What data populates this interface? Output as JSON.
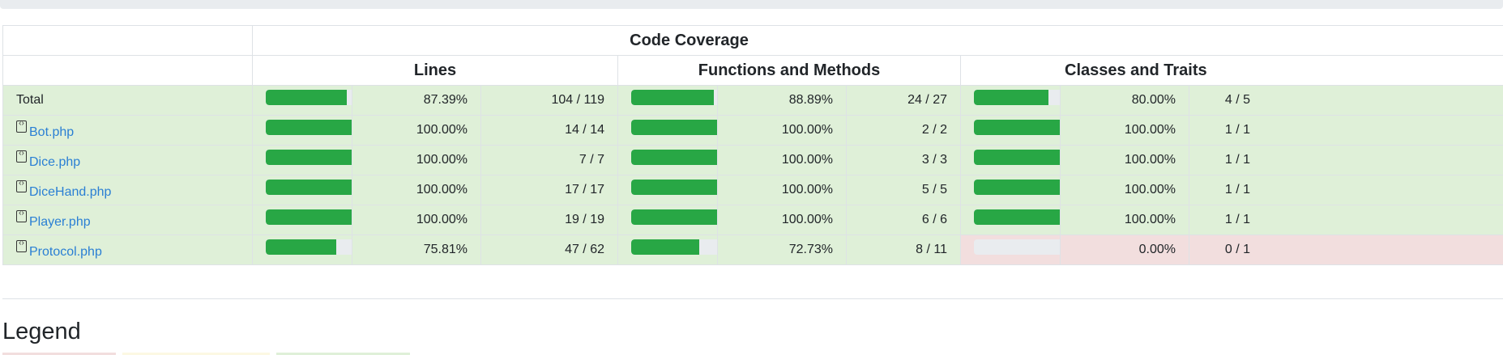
{
  "header": {
    "code_coverage": "Code Coverage",
    "columns": [
      "Lines",
      "Functions and Methods",
      "Classes and Traits"
    ]
  },
  "rows": [
    {
      "name": "Total",
      "is_file": false,
      "lines": {
        "pct": "87.39%",
        "count": "104 / 119",
        "fill": 0.8739
      },
      "functions": {
        "pct": "88.89%",
        "count": "24 / 27",
        "fill": 0.8889
      },
      "classes": {
        "pct": "80.00%",
        "count": "4 / 5",
        "fill": 0.8
      }
    },
    {
      "name": "Bot.php",
      "is_file": true,
      "lines": {
        "pct": "100.00%",
        "count": "14 / 14",
        "fill": 1.0
      },
      "functions": {
        "pct": "100.00%",
        "count": "2 / 2",
        "fill": 1.0
      },
      "classes": {
        "pct": "100.00%",
        "count": "1 / 1",
        "fill": 1.0
      }
    },
    {
      "name": "Dice.php",
      "is_file": true,
      "lines": {
        "pct": "100.00%",
        "count": "7 / 7",
        "fill": 1.0
      },
      "functions": {
        "pct": "100.00%",
        "count": "3 / 3",
        "fill": 1.0
      },
      "classes": {
        "pct": "100.00%",
        "count": "1 / 1",
        "fill": 1.0
      }
    },
    {
      "name": "DiceHand.php",
      "is_file": true,
      "lines": {
        "pct": "100.00%",
        "count": "17 / 17",
        "fill": 1.0
      },
      "functions": {
        "pct": "100.00%",
        "count": "5 / 5",
        "fill": 1.0
      },
      "classes": {
        "pct": "100.00%",
        "count": "1 / 1",
        "fill": 1.0
      }
    },
    {
      "name": "Player.php",
      "is_file": true,
      "lines": {
        "pct": "100.00%",
        "count": "19 / 19",
        "fill": 1.0
      },
      "functions": {
        "pct": "100.00%",
        "count": "6 / 6",
        "fill": 1.0
      },
      "classes": {
        "pct": "100.00%",
        "count": "1 / 1",
        "fill": 1.0
      }
    },
    {
      "name": "Protocol.php",
      "is_file": true,
      "lines": {
        "pct": "75.81%",
        "count": "47 / 62",
        "fill": 0.7581
      },
      "functions": {
        "pct": "72.73%",
        "count": "8 / 11",
        "fill": 0.7273
      },
      "classes": {
        "pct": "0.00%",
        "count": "0 / 1",
        "fill": 0.0,
        "status": "danger"
      }
    }
  ],
  "legend": {
    "title": "Legend"
  },
  "colors": {
    "success_bg": "#dff0d8",
    "danger_bg": "#f2dede",
    "warning_bg": "#fcf8e3",
    "bar_fill": "#28a745",
    "bar_track": "#e9ecef",
    "link": "#2a7fd4"
  }
}
